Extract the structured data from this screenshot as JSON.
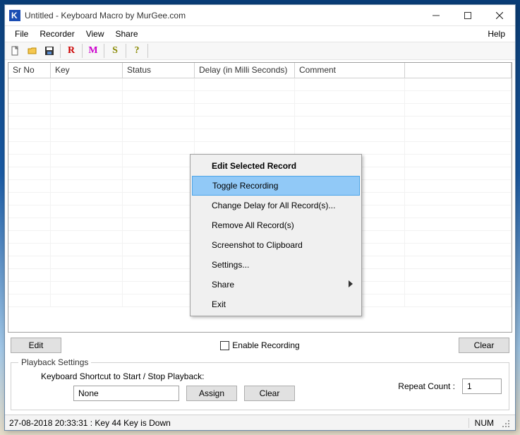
{
  "window": {
    "title": "Untitled - Keyboard Macro by MurGee.com"
  },
  "menu": {
    "file": "File",
    "recorder": "Recorder",
    "view": "View",
    "share": "Share",
    "help": "Help"
  },
  "toolbar_letters": {
    "r": "R",
    "m": "M",
    "s": "S",
    "q": "?"
  },
  "grid": {
    "cols": [
      "Sr No",
      "Key",
      "Status",
      "Delay (in Milli Seconds)",
      "Comment"
    ]
  },
  "buttons": {
    "edit": "Edit",
    "clear": "Clear",
    "assign": "Assign",
    "clear2": "Clear"
  },
  "checkbox": {
    "enable_recording": "Enable Recording"
  },
  "playback": {
    "legend": "Playback Settings",
    "shortcut_label": "Keyboard Shortcut to Start / Stop Playback:",
    "shortcut_value": "None",
    "repeat_label": "Repeat Count :",
    "repeat_value": "1"
  },
  "status": {
    "left": "27-08-2018 20:33:31 : Key 44 Key is Down",
    "num": "NUM"
  },
  "context_menu": {
    "title": "Edit Selected Record",
    "items": [
      {
        "label": "Toggle Recording",
        "highlight": true
      },
      {
        "label": "Change Delay for All Record(s)..."
      },
      {
        "label": "Remove All Record(s)"
      },
      {
        "label": "Screenshot to Clipboard"
      },
      {
        "label": "Settings..."
      },
      {
        "label": "Share",
        "submenu": true
      },
      {
        "label": "Exit"
      }
    ]
  }
}
